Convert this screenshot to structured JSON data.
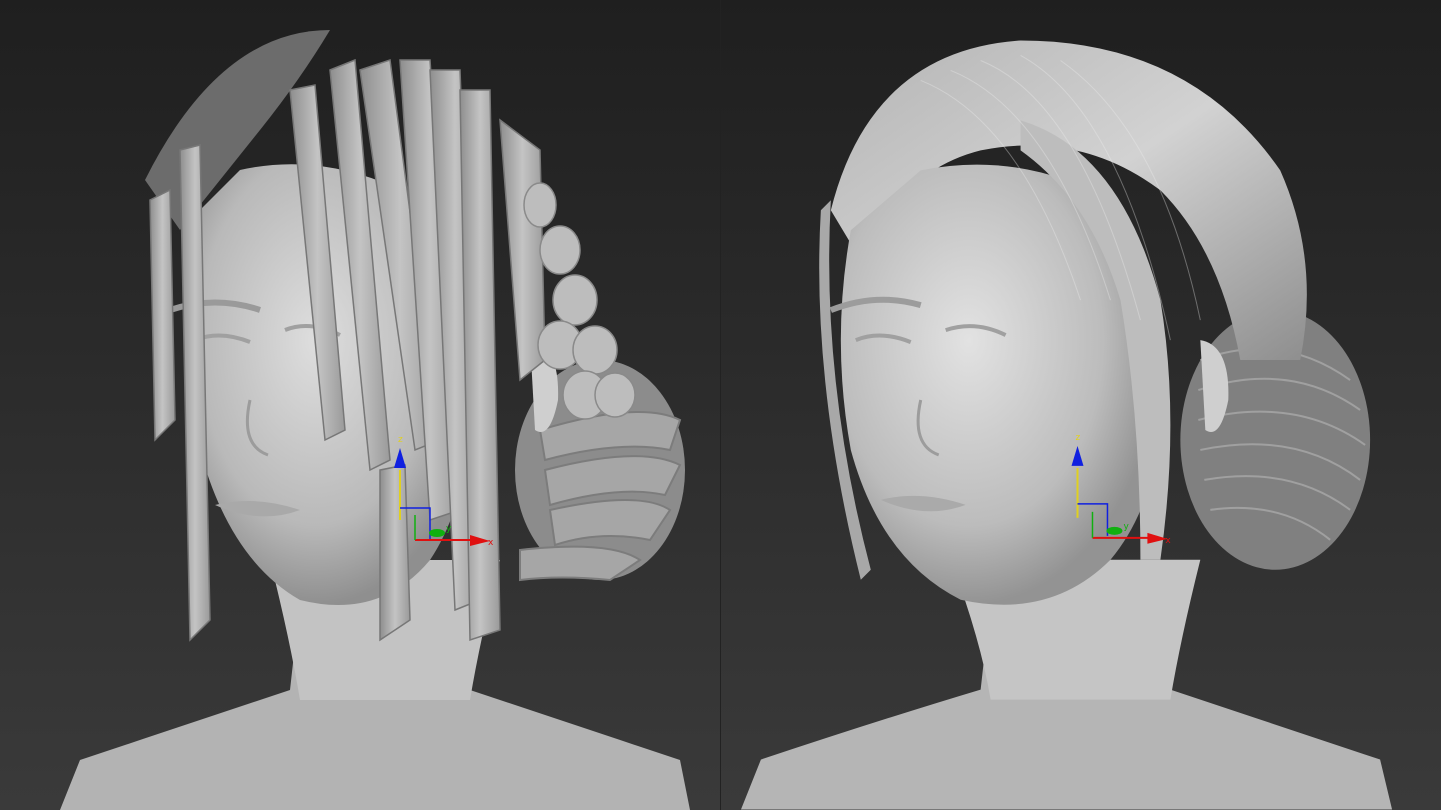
{
  "viewports": [
    {
      "view": "left",
      "gizmo": {
        "x_label": "x",
        "y_label": "y",
        "z_label": "z"
      },
      "colors": {
        "x_axis": "#e01010",
        "y_axis": "#10b010",
        "z_axis": "#1020e0",
        "z_stem": "#e0d020"
      }
    },
    {
      "view": "right",
      "gizmo": {
        "x_label": "x",
        "y_label": "y",
        "z_label": "z"
      },
      "colors": {
        "x_axis": "#e01010",
        "y_axis": "#10b010",
        "z_axis": "#1020e0",
        "z_stem": "#e0d020"
      }
    }
  ]
}
